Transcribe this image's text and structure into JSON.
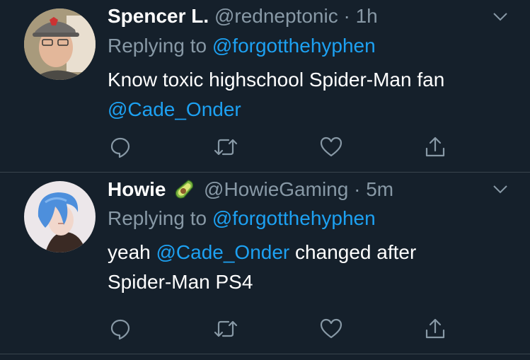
{
  "tweets": [
    {
      "name": "Spencer L.",
      "handle": "@redneptonic",
      "separator": " · ",
      "time": "1h",
      "reply_prefix": "Replying to ",
      "reply_mention": "@forgotthehyphen",
      "body_text_1": "Know toxic highschool Spider-Man fan",
      "body_mention_1": "@Cade_Onder",
      "avatar_icon": "person-with-cap-avatar"
    },
    {
      "name": "Howie",
      "name_emoji": "avocado-emoji",
      "handle": "@HowieGaming",
      "separator": " · ",
      "time": "5m",
      "reply_prefix": "Replying to ",
      "reply_mention": "@forgotthehyphen",
      "body_prefix": "yeah ",
      "body_mention": "@Cade_Onder",
      "body_suffix": " changed after",
      "body_line2": "Spider-Man PS4",
      "avatar_icon": "blue-hair-character-avatar"
    }
  ],
  "actions": {
    "reply_icon": "reply-icon",
    "retweet_icon": "retweet-icon",
    "like_icon": "heart-icon",
    "share_icon": "share-icon"
  },
  "colors": {
    "background": "#15202b",
    "divider": "#38444d",
    "secondary_text": "#8899a6",
    "link": "#1da1f2",
    "primary_text": "#ffffff"
  }
}
